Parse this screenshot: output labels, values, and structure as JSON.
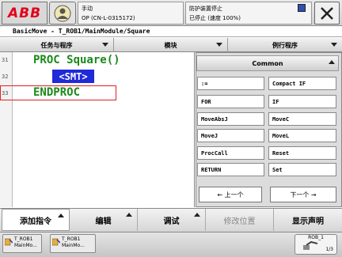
{
  "header": {
    "logo_text": "ABB",
    "status_left_line1": "手动",
    "status_left_line2": "OP (CN-L-0315172)",
    "status_right_line1": "防护装置停止",
    "status_right_line2": "已停止 (速度 100%)"
  },
  "breadcrumb": "BasicMove - T_ROB1/MainModule/Square",
  "tabs": [
    {
      "label": "任务与程序"
    },
    {
      "label": "模块"
    },
    {
      "label": "例行程序"
    }
  ],
  "editor": {
    "lines": [
      {
        "num": "31",
        "code": "PROC Square()"
      },
      {
        "num": "32",
        "code": "<SMT>"
      },
      {
        "num": "33",
        "code": "ENDPROC"
      }
    ]
  },
  "panel": {
    "title": "Common",
    "instructions": [
      [
        ":=",
        "Compact IF"
      ],
      [
        "FOR",
        "IF"
      ],
      [
        "MoveAbsJ",
        "MoveC"
      ],
      [
        "MoveJ",
        "MoveL"
      ],
      [
        "ProcCall",
        "Reset"
      ],
      [
        "RETURN",
        "Set"
      ]
    ],
    "prev_label": "←  上一个",
    "next_label": "下一个  →"
  },
  "toolbar": {
    "add_instruction": "添加指令",
    "edit": "编辑",
    "debug": "调试",
    "modify_position": "修改位置",
    "show_declaration": "显示声明"
  },
  "taskbar": {
    "task1_line1": "T_ROB1",
    "task1_line2": "MainMo...",
    "task2_line1": "T_ROB1",
    "task2_line2": "MainMo...",
    "robot_label": "ROB_1",
    "robot_fraction": "1/3"
  },
  "colors": {
    "code_green": "#1a8a1a",
    "smt_blue": "#1f2ad8",
    "highlight_red": "#e02020",
    "logo_red": "#e3001b"
  }
}
